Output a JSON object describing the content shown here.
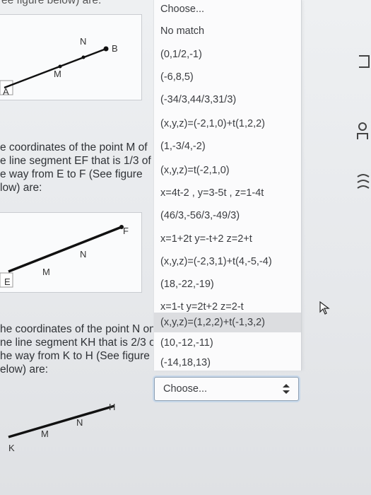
{
  "top_cut_text": "ee figure below) are:",
  "figures": [
    {
      "labels": [
        "A",
        "M",
        "N",
        "B"
      ]
    },
    {
      "labels": [
        "E",
        "M",
        "N",
        "F"
      ]
    },
    {
      "labels": [
        "K",
        "M",
        "N",
        "H"
      ]
    }
  ],
  "question2": {
    "lines": [
      "e coordinates of the point M of",
      "e line segment EF that is 1/3 of",
      "e way from E to F (See figure",
      "low) are:"
    ]
  },
  "question3": {
    "lines": [
      "he coordinates of the point N on",
      "ne line segment KH that is 2/3 of",
      "he way from K to H (See figure",
      "elow) are:"
    ]
  },
  "dropdown": {
    "options": [
      "Choose...",
      "No match",
      "(0,1/2,-1)",
      "(-6,8,5)",
      "(-34/3,44/3,31/3)",
      "(x,y,z)=(-2,1,0)+t(1,2,2)",
      "(1,-3/4,-2)",
      "(x,y,z)=t(-2,1,0)",
      "x=4t-2 , y=3-5t , z=1-4t",
      "(46/3,-56/3,-49/3)",
      "x=1+2t y=-t+2 z=2+t",
      "(x,y,z)=(-2,3,1)+t(4,-5,-4)",
      "(18,-22,-19)",
      "x=1-t y=2t+2 z=2-t",
      "(x,y,z)=(1,2,2)+t(-1,3,2)",
      "(10,-12,-11)",
      "(-14,18,13)"
    ],
    "highlighted_index": 14
  },
  "select": {
    "value": "Choose..."
  },
  "colors": {
    "highlight": "#dcdde0",
    "focus_ring": "#c7d8ea",
    "figure_line": "#111111"
  },
  "icons": [
    "flag-icon",
    "user-icon",
    "settings-icon",
    "mouse-pointer-icon"
  ]
}
